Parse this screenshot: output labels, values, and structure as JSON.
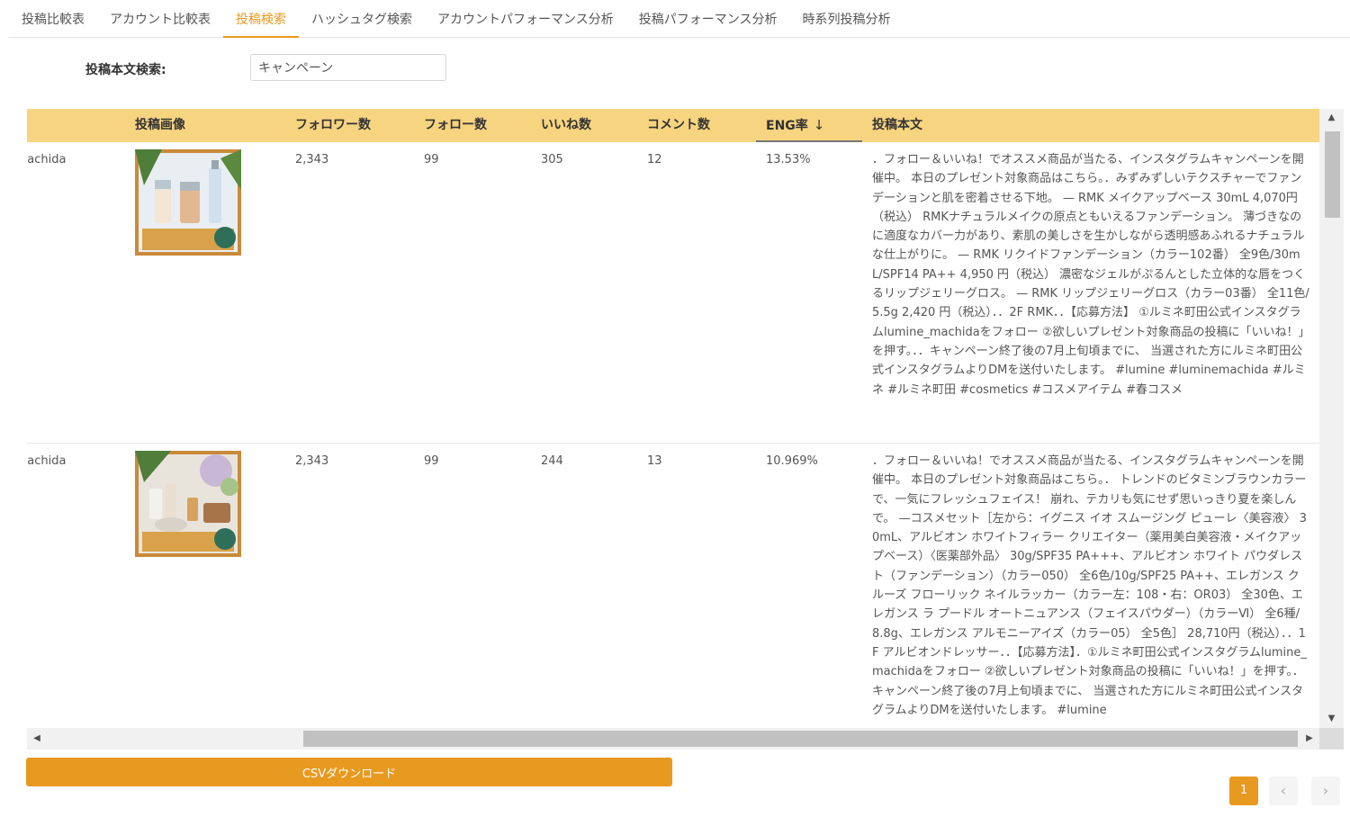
{
  "tabs": [
    {
      "label": "投稿比較表"
    },
    {
      "label": "アカウント比較表"
    },
    {
      "label": "投稿検索"
    },
    {
      "label": "ハッシュタグ検索"
    },
    {
      "label": "アカウントパフォーマンス分析"
    },
    {
      "label": "投稿パフォーマンス分析"
    },
    {
      "label": "時系列投稿分析"
    }
  ],
  "active_tab": "投稿検索",
  "search": {
    "label": "投稿本文検索:",
    "value": "キャンペーン"
  },
  "table": {
    "headers": {
      "image": "投稿画像",
      "followers": "フォロワー数",
      "following": "フォロー数",
      "likes": "いいね数",
      "comments": "コメント数",
      "eng": "ENG率",
      "body": "投稿本文"
    },
    "sort_icon": "arrow-down-icon",
    "rows": [
      {
        "account": "nachida",
        "followers": "2,343",
        "following": "99",
        "likes": "305",
        "comments": "12",
        "eng": "13.53%",
        "body": "．フォロー＆いいね！でオススメ商品が当たる、インスタグラムキャンペーンを開催中。 本日のプレゼント対象商品はこちら。．みずみずしいテクスチャーでファンデーションと肌を密着させる下地。 — RMK メイクアップベース 30mL 4,070円（税込） RMKナチュラルメイクの原点ともいえるファンデーション。 薄づきなのに適度なカバー力があり、素肌の美しさを生かしながら透明感あふれるナチュラルな仕上がりに。 — RMK リクイドファンデーション（カラー102番） 全9色/30mL/SPF14 PA++ 4,950 円（税込） 濃密なジェルがぷるんとした立体的な唇をつくるリップジェリーグロス。 — RMK リップジェリーグロス（カラー03番） 全11色/5.5g 2,420 円（税込）．．2F RMK．．【応募方法】 ①ルミネ町田公式インスタグラムlumine_machidaをフォロー ②欲しいプレゼント対象商品の投稿に「いいね！」を押す。．．キャンペーン終了後の7月上旬頃までに、 当選された方にルミネ町田公式インスタグラムよりDMを送付いたします。 #lumine #luminemachida #ルミネ #ルミネ町田 #cosmetics #コスメアイテム #春コスメ"
      },
      {
        "account": "nachida",
        "followers": "2,343",
        "following": "99",
        "likes": "244",
        "comments": "13",
        "eng": "10.969%",
        "body": "．フォロー＆いいね！でオススメ商品が当たる、インスタグラムキャンペーンを開催中。 本日のプレゼント対象商品はこちら。． トレンドのビタミンブラウンカラーで、一気にフレッシュフェイス！ 崩れ、テカリも気にせず思いっきり夏を楽しんで。 —コスメセット［左から：イグニス イオ スムージング ピューレ〈美容液〉 30mL、アルビオン ホワイトフィラー クリエイター（薬用美白美容液・メイクアップベース）〈医薬部外品〉 30g/SPF35 PA+++、アルビオン ホワイト パウダレスト（ファンデーション）（カラー050） 全6色/10g/SPF25 PA++、エレガンス クルーズ フローリック ネイルラッカー（カラー左：108・右：OR03） 全30色、エレガンス ラ プードル オートニュアンス（フェイスパウダー）（カラーⅥ） 全6種/8.8g、エレガンス アルモニーアイズ（カラー05） 全5色］ 28,710円（税込）．．1F アルビオンドレッサー．．【応募方法】．①ルミネ町田公式インスタグラムlumine_machidaをフォロー ②欲しいプレゼント対象商品の投稿に「いいね！」を押す。．キャンペーン終了後の7月上旬頃までに、 当選された方にルミネ町田公式インスタグラムよりDMを送付いたします。 #lumine"
      }
    ]
  },
  "csv_button": "CSVダウンロード",
  "pagination": {
    "current": "1",
    "prev_icon": "chevron-left-icon",
    "next_icon": "chevron-right-icon"
  },
  "colors": {
    "accent": "#e8991f",
    "header_bg": "#f7d480"
  }
}
